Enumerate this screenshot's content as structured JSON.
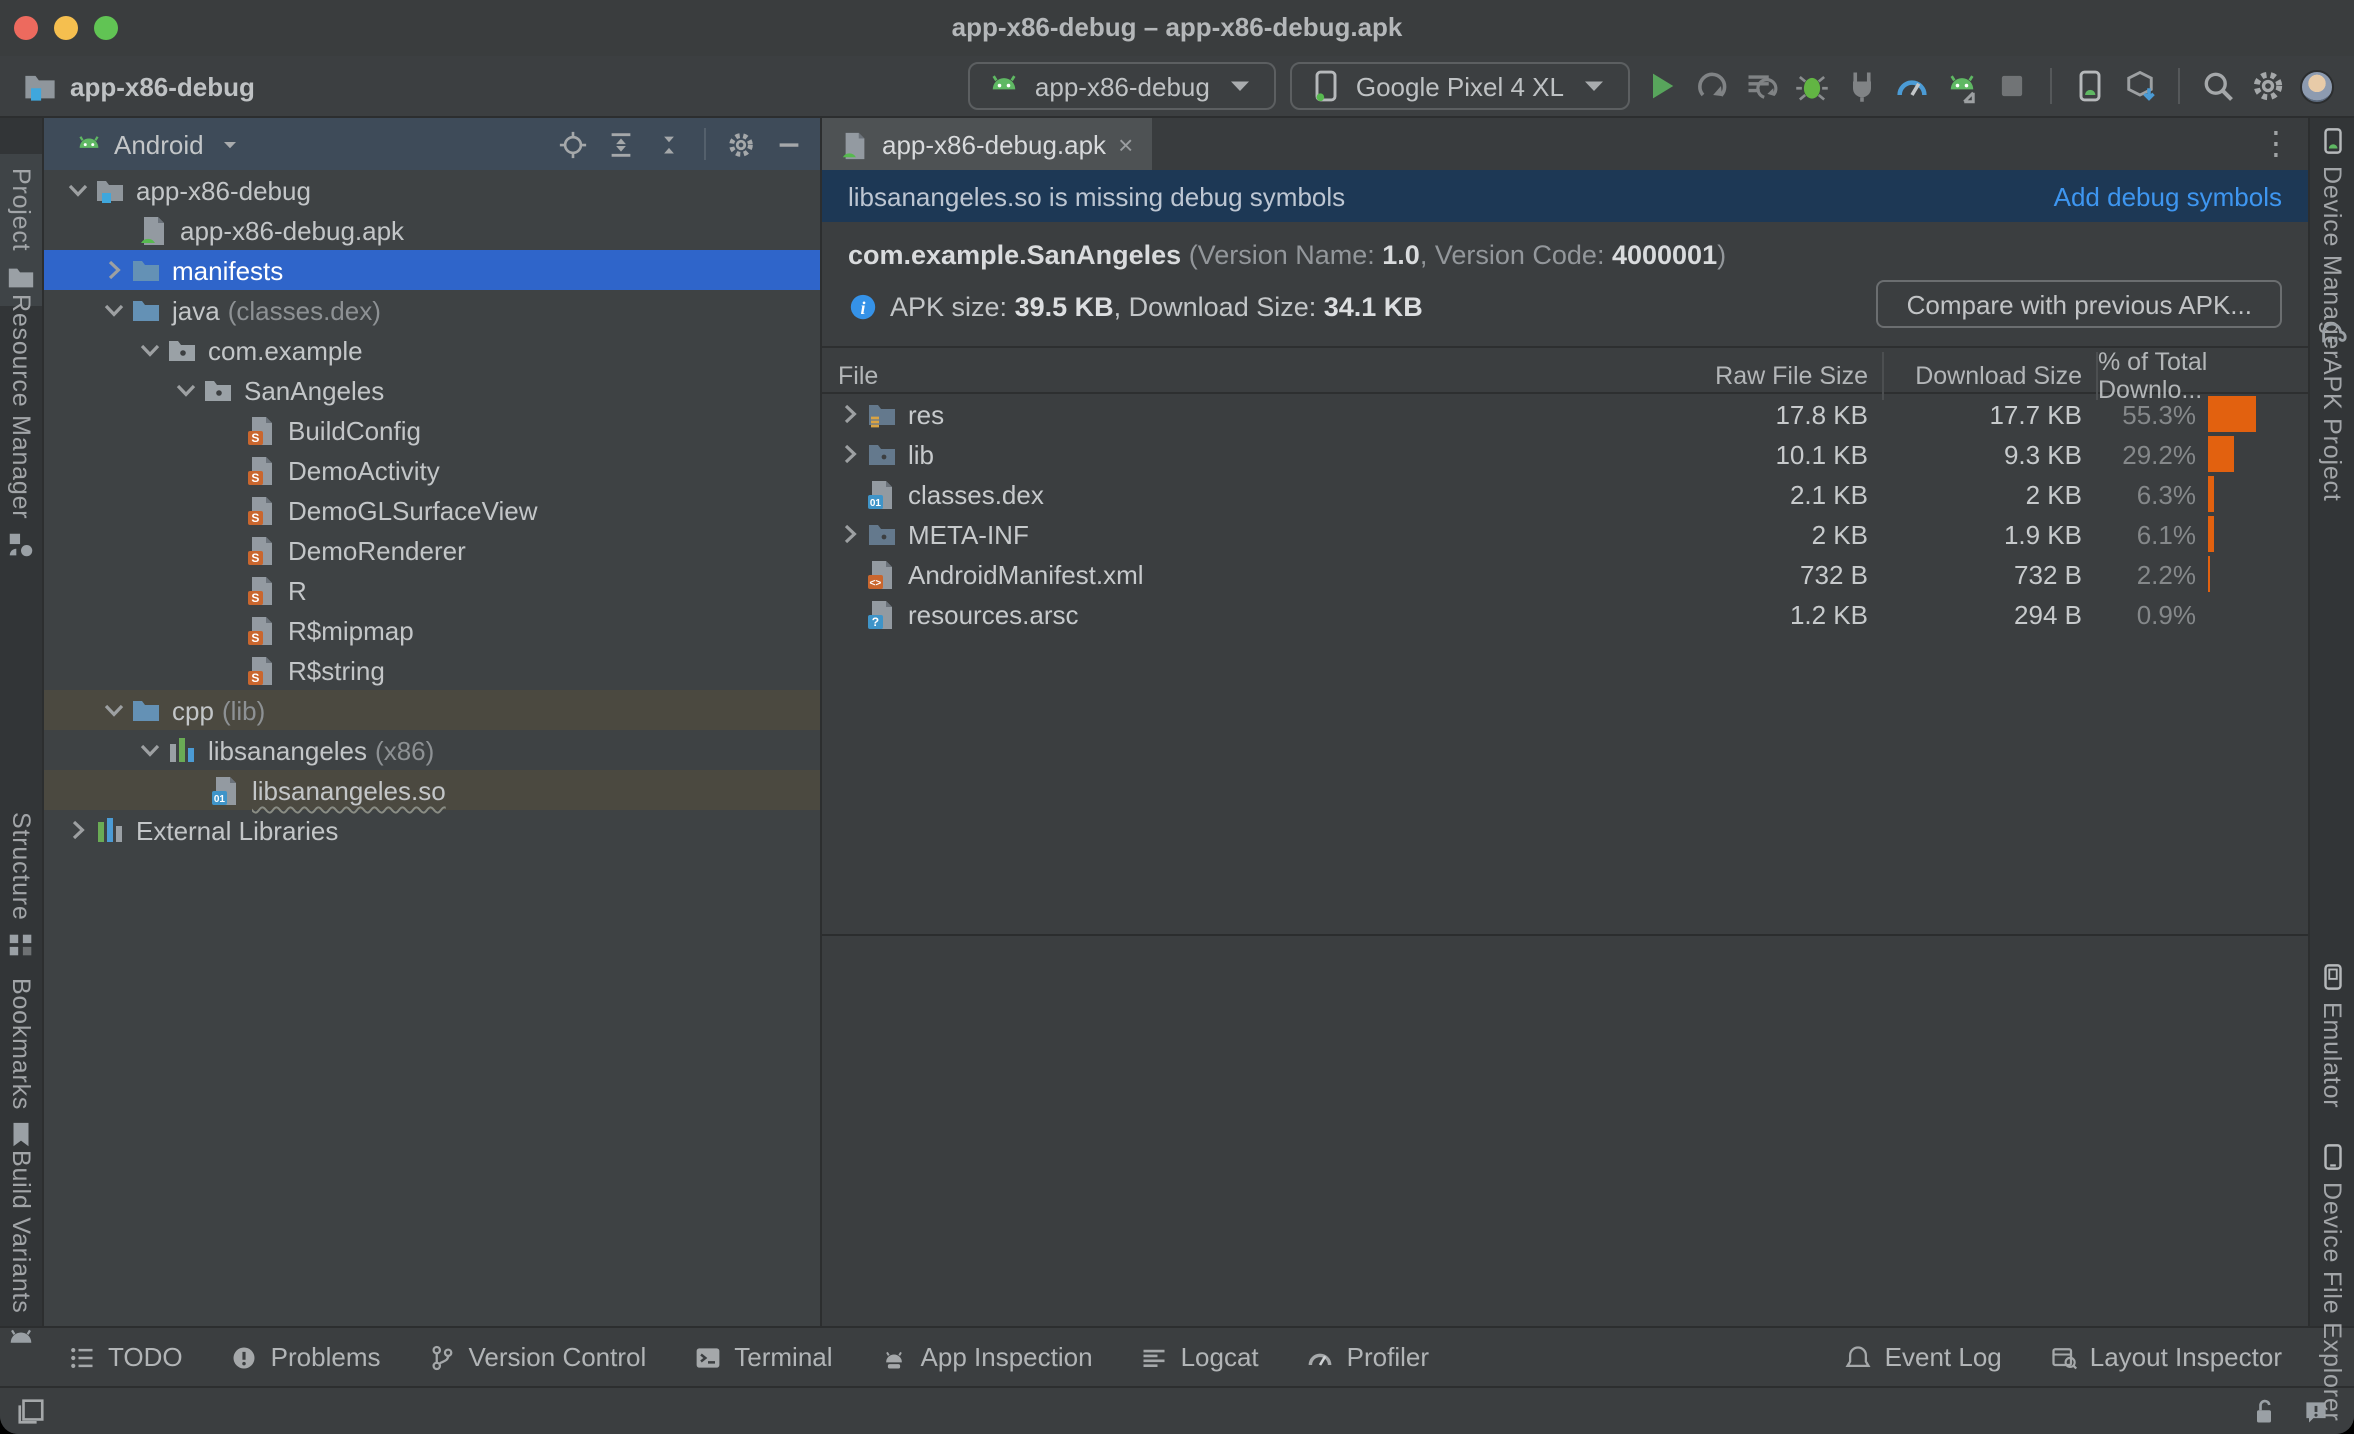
{
  "window": {
    "title": "app-x86-debug – app-x86-debug.apk"
  },
  "toolbar": {
    "project_label": "app-x86-debug",
    "project_icon": "project-folder-icon",
    "run_config": {
      "icon": "android-icon",
      "label": "app-x86-debug"
    },
    "device_select": {
      "icon": "phone-icon",
      "label": "Google Pixel 4 XL"
    },
    "actions": [
      {
        "name": "run-button",
        "icon": "run"
      },
      {
        "name": "apply-changes-button",
        "icon": "apply-changes"
      },
      {
        "name": "apply-code-changes-button",
        "icon": "apply-code"
      },
      {
        "name": "debug-button",
        "icon": "debug"
      },
      {
        "name": "attach-debugger-button",
        "icon": "attach"
      },
      {
        "name": "profile-button",
        "icon": "gauge"
      },
      {
        "name": "profile-apk-button",
        "icon": "profile-apk"
      },
      {
        "name": "stop-button",
        "icon": "stop"
      }
    ],
    "tools": [
      {
        "name": "device-manager-button",
        "icon": "device-manager"
      },
      {
        "name": "sdk-manager-button",
        "icon": "sdk-manager"
      }
    ],
    "misc": [
      {
        "name": "search-everywhere-button",
        "icon": "search"
      },
      {
        "name": "settings-button",
        "icon": "gear"
      }
    ]
  },
  "left_stripe": [
    {
      "label": "Project",
      "icon": "folder",
      "active": true
    },
    {
      "label": "Resource Manager",
      "icon": "resource-manager"
    },
    {
      "label": "Structure",
      "icon": "structure"
    },
    {
      "label": "Bookmarks",
      "icon": "bookmark"
    },
    {
      "label": "Build Variants",
      "icon": "android-head"
    }
  ],
  "right_stripe": [
    {
      "label": "Device Manager",
      "icon": "device-manager"
    },
    {
      "label": "APK Project",
      "icon": "elephant"
    },
    {
      "label": "Emulator",
      "icon": "emulator"
    },
    {
      "label": "Device File Explorer",
      "icon": "phone-outline"
    }
  ],
  "project_panel": {
    "view": "Android",
    "header_icons": [
      "locate-icon",
      "expand-all-icon",
      "collapse-all-icon",
      "settings-icon",
      "hide-icon"
    ],
    "tree": [
      {
        "label": "app-x86-debug",
        "icon": "module-folder",
        "level": 0,
        "chevron": "down"
      },
      {
        "label": "app-x86-debug.apk",
        "icon": "apk-file",
        "level": 1,
        "chevron": null
      },
      {
        "label": "manifests",
        "icon": "folder-blue",
        "level": 1,
        "chevron": "right",
        "state": "selected"
      },
      {
        "label": "java",
        "suffix": "(classes.dex)",
        "icon": "folder-blue",
        "level": 1,
        "chevron": "down"
      },
      {
        "label": "com.example",
        "icon": "package",
        "level": 2,
        "chevron": "down"
      },
      {
        "label": "SanAngeles",
        "icon": "package",
        "level": 3,
        "chevron": "down"
      },
      {
        "label": "BuildConfig",
        "icon": "class-file",
        "level": 4,
        "chevron": null
      },
      {
        "label": "DemoActivity",
        "icon": "class-file",
        "level": 4,
        "chevron": null
      },
      {
        "label": "DemoGLSurfaceView",
        "icon": "class-file",
        "level": 4,
        "chevron": null
      },
      {
        "label": "DemoRenderer",
        "icon": "class-file",
        "level": 4,
        "chevron": null
      },
      {
        "label": "R",
        "icon": "class-file",
        "level": 4,
        "chevron": null
      },
      {
        "label": "R$mipmap",
        "icon": "class-file",
        "level": 4,
        "chevron": null
      },
      {
        "label": "R$string",
        "icon": "class-file",
        "level": 4,
        "chevron": null
      },
      {
        "label": "cpp",
        "suffix": "(lib)",
        "icon": "folder-blue",
        "level": 1,
        "chevron": "down",
        "state": "olive"
      },
      {
        "label": "libsanangeles",
        "suffix": "(x86)",
        "icon": "library",
        "level": 2,
        "chevron": "down"
      },
      {
        "label": "libsanangeles.so",
        "icon": "so-file",
        "level": 3,
        "chevron": null,
        "state": "olive",
        "underline": true
      },
      {
        "label": "External Libraries",
        "icon": "ext-lib",
        "level": 0,
        "chevron": "right"
      }
    ]
  },
  "editor": {
    "tab": "app-x86-debug.apk",
    "banner": {
      "message": "libsanangeles.so is missing debug symbols",
      "action": "Add debug symbols"
    },
    "apk_info": {
      "package": "com.example.SanAngeles",
      "version_prefix": "(Version Name: ",
      "version_name": "1.0",
      "version_mid": ", Version Code: ",
      "version_code": "4000001",
      "version_suffix": ")",
      "size_label": "APK size: ",
      "apk_size": "39.5 KB",
      "download_label": ", Download Size: ",
      "download_size": "34.1 KB",
      "compare_button": "Compare with previous APK..."
    },
    "table": {
      "columns": [
        "File",
        "Raw File Size",
        "Download Size",
        "% of Total Downlo..."
      ],
      "rows": [
        {
          "name": "res",
          "icon": "folder-res",
          "chevron": true,
          "raw": "17.8 KB",
          "download": "17.7 KB",
          "pct": "55.3%",
          "pct_value": 55.3
        },
        {
          "name": "lib",
          "icon": "folder-plain",
          "chevron": true,
          "raw": "10.1 KB",
          "download": "9.3 KB",
          "pct": "29.2%",
          "pct_value": 29.2
        },
        {
          "name": "classes.dex",
          "icon": "dex-file",
          "chevron": false,
          "raw": "2.1 KB",
          "download": "2 KB",
          "pct": "6.3%",
          "pct_value": 6.3
        },
        {
          "name": "META-INF",
          "icon": "folder-plain",
          "chevron": true,
          "raw": "2 KB",
          "download": "1.9 KB",
          "pct": "6.1%",
          "pct_value": 6.1
        },
        {
          "name": "AndroidManifest.xml",
          "icon": "xml-file",
          "chevron": false,
          "raw": "732 B",
          "download": "732 B",
          "pct": "2.2%",
          "pct_value": 2.2
        },
        {
          "name": "resources.arsc",
          "icon": "arsc-file",
          "chevron": false,
          "raw": "1.2 KB",
          "download": "294 B",
          "pct": "0.9%",
          "pct_value": 0.9
        }
      ]
    }
  },
  "bottom_bar": {
    "left": [
      {
        "label": "TODO",
        "icon": "todo"
      },
      {
        "label": "Problems",
        "icon": "problems"
      },
      {
        "label": "Version Control",
        "icon": "branch"
      },
      {
        "label": "Terminal",
        "icon": "terminal"
      },
      {
        "label": "App Inspection",
        "icon": "app-inspection"
      },
      {
        "label": "Logcat",
        "icon": "logcat"
      },
      {
        "label": "Profiler",
        "icon": "gauge-small"
      }
    ],
    "right": [
      {
        "label": "Event Log",
        "icon": "event-log"
      },
      {
        "label": "Layout Inspector",
        "icon": "layout-inspector"
      }
    ]
  },
  "status_bar": {
    "icons": [
      "tool-windows-icon",
      "unlock-icon",
      "notification-icon"
    ]
  },
  "colors": {
    "accent_blue": "#2f65ca",
    "banner_bg": "#1d3855",
    "link_blue": "#3e96f0",
    "bar_orange": "#e2610f",
    "olive_highlight": "#4b4940"
  }
}
